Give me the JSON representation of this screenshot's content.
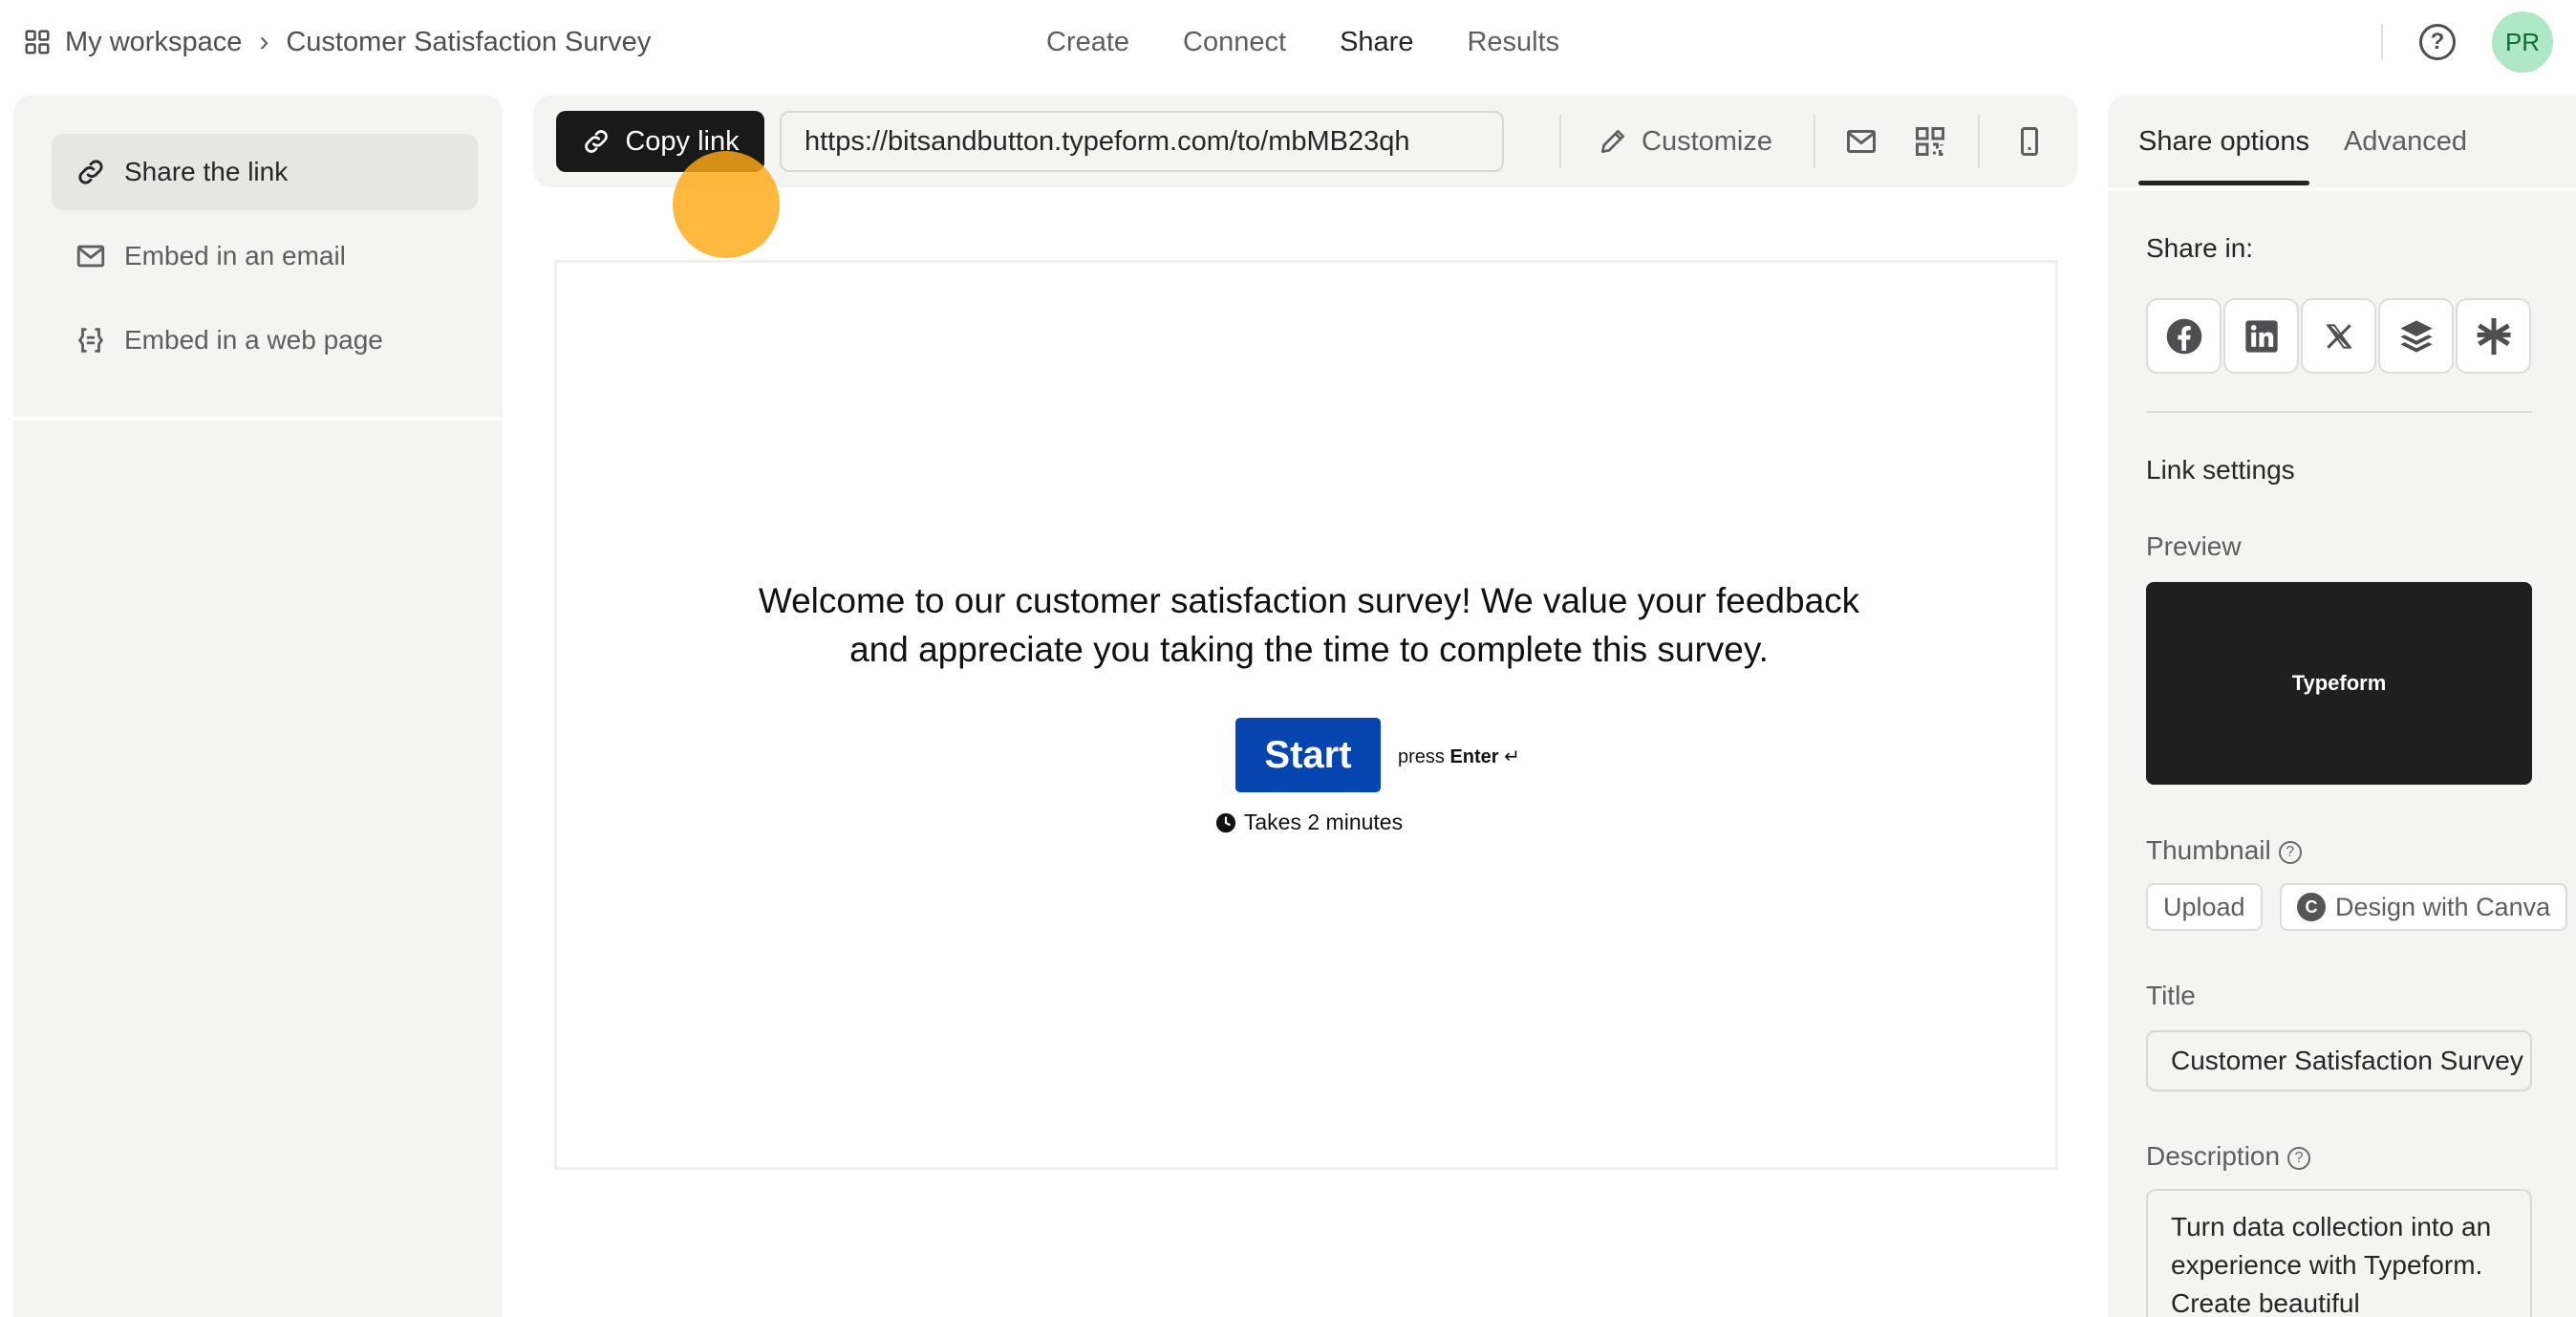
{
  "breadcrumb": {
    "workspace": "My workspace",
    "separator": "›",
    "form": "Customer Satisfaction Survey"
  },
  "nav": {
    "items": [
      "Create",
      "Connect",
      "Share",
      "Results"
    ],
    "active": "Share"
  },
  "user": {
    "initials": "PR",
    "avatar_color": "#aee8c6"
  },
  "sidebar": {
    "items": [
      {
        "label": "Share the link",
        "icon": "link-icon",
        "active": true
      },
      {
        "label": "Embed in an email",
        "icon": "mail-icon",
        "active": false
      },
      {
        "label": "Embed in a web page",
        "icon": "embed-code-icon",
        "active": false
      }
    ]
  },
  "toolbar": {
    "copy_label": "Copy link",
    "url": "https://bitsandbutton.typeform.com/to/mbMB23qh",
    "customize_label": "Customize",
    "icons": [
      "mail-icon",
      "qr-code-icon",
      "mobile-preview-icon"
    ]
  },
  "preview": {
    "welcome_line1": "Welcome to our customer satisfaction survey! We value your feedback",
    "welcome_line2": "and appreciate you taking the time to complete this survey.",
    "start_label": "Start",
    "press_label": "press",
    "enter_label": "Enter",
    "enter_symbol": "↵",
    "duration": "Takes 2 minutes",
    "button_color": "#0445af"
  },
  "right_panel": {
    "tabs": [
      "Share options",
      "Advanced"
    ],
    "active_tab": "Share options",
    "share_in_label": "Share in:",
    "social": [
      "facebook-icon",
      "linkedin-icon",
      "x-icon",
      "buffer-icon",
      "linktree-icon"
    ],
    "link_settings_label": "Link settings",
    "preview_label": "Preview",
    "preview_card_text": "Typeform",
    "thumbnail_label": "Thumbnail",
    "upload_label": "Upload",
    "canva_label": "Design with Canva",
    "title_label": "Title",
    "title_value": "Customer Satisfaction Survey",
    "description_label": "Description",
    "description_value": "Turn data collection into an experience with Typeform. Create beautiful"
  }
}
